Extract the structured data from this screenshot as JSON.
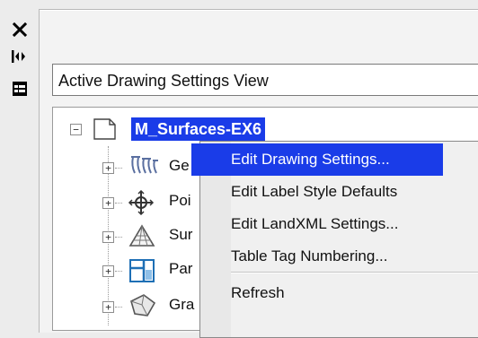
{
  "side_toolbar": {
    "close_glyph": "✕",
    "toggle_glyph": "|◀▶",
    "properties_glyph": "▤"
  },
  "view_selector": {
    "value": "Active Drawing Settings View"
  },
  "tree": {
    "root": {
      "label": "M_Surfaces-EX6",
      "expander": "−"
    },
    "children": [
      {
        "label": "Ge",
        "icon": "general-icon",
        "expander": "+"
      },
      {
        "label": "Poi",
        "icon": "point-icon",
        "expander": "+"
      },
      {
        "label": "Sur",
        "icon": "surface-icon",
        "expander": "+"
      },
      {
        "label": "Par",
        "icon": "parcel-icon",
        "expander": "+"
      },
      {
        "label": "Gra",
        "icon": "grading-icon",
        "expander": "+"
      }
    ]
  },
  "context_menu": {
    "items": [
      {
        "label": "Edit Drawing Settings...",
        "highlighted": true
      },
      {
        "label": "Edit Label Style Defaults"
      },
      {
        "label": "Edit LandXML Settings..."
      },
      {
        "label": "Table Tag Numbering..."
      },
      {
        "label": "Refresh"
      }
    ]
  },
  "colors": {
    "selection": "#1a3ce8",
    "background": "#ececec"
  }
}
